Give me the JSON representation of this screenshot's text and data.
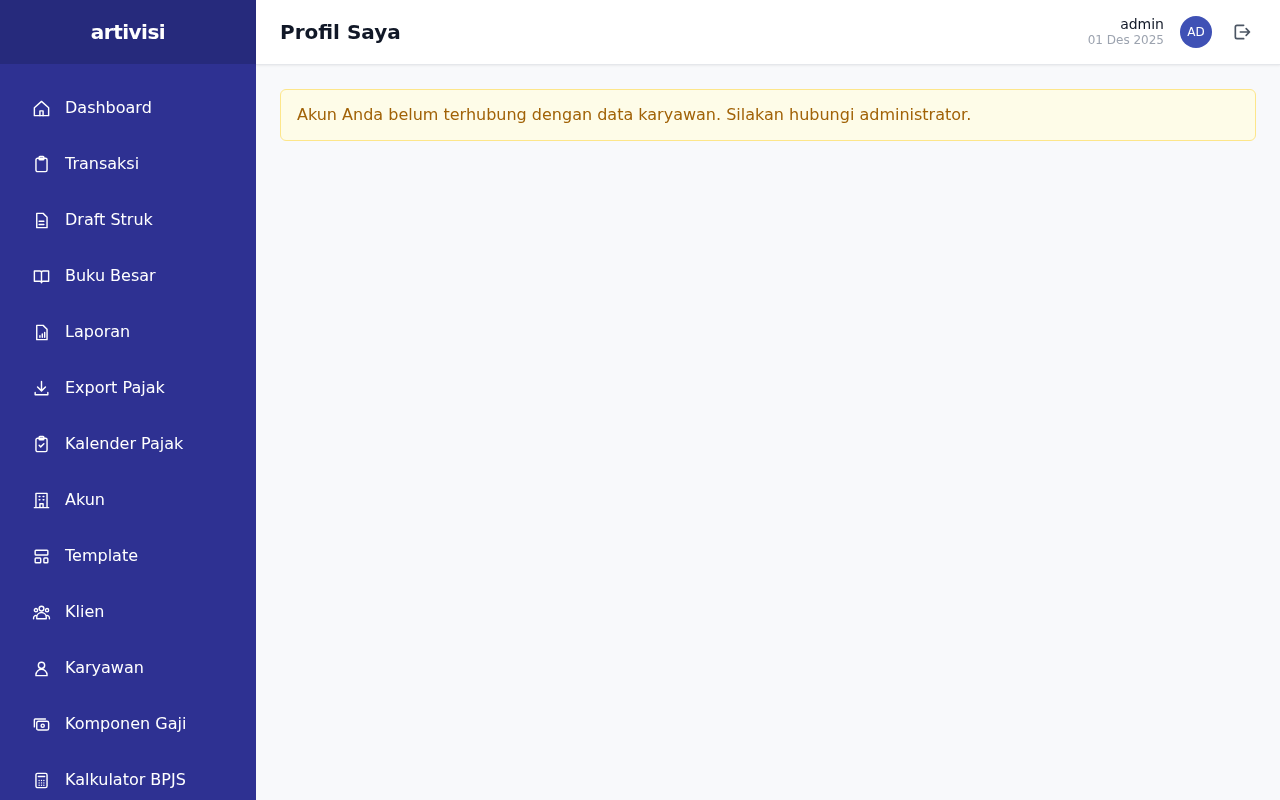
{
  "sidebar": {
    "logo": "artivisi",
    "items": [
      {
        "label": "Dashboard",
        "selected": false
      },
      {
        "label": "Transaksi",
        "selected": false
      },
      {
        "label": "Draft Struk",
        "selected": false
      },
      {
        "label": "Buku Besar",
        "selected": false
      },
      {
        "label": "Laporan",
        "selected": false
      },
      {
        "label": "Export Pajak",
        "selected": false
      },
      {
        "label": "Kalender Pajak",
        "selected": false
      },
      {
        "label": "Akun",
        "selected": false
      },
      {
        "label": "Template",
        "selected": false
      },
      {
        "label": "Klien",
        "selected": false
      },
      {
        "label": "Karyawan",
        "selected": false
      },
      {
        "label": "Komponen Gaji",
        "selected": false
      },
      {
        "label": "Kalkulator BPJS",
        "selected": false
      }
    ]
  },
  "header": {
    "title": "Profil Saya",
    "user": {
      "name": "admin",
      "date": "01 Des 2025",
      "initials": "AD"
    }
  },
  "alert": {
    "text": "Akun Anda belum terhubung dengan data karyawan. Silakan hubungi administrator."
  }
}
